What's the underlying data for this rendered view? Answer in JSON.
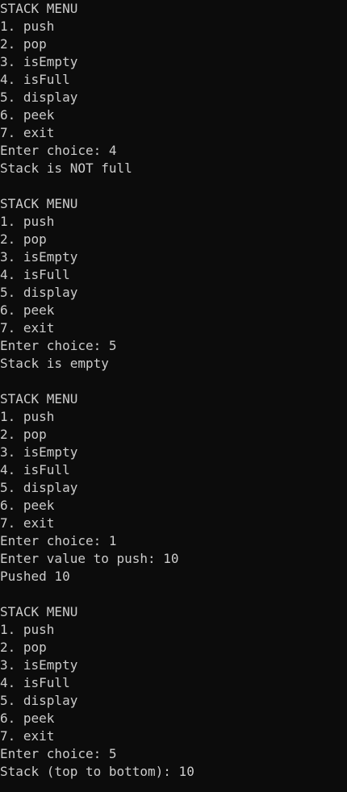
{
  "console": {
    "lines": [
      "STACK MENU",
      "1. push",
      "2. pop",
      "3. isEmpty",
      "4. isFull",
      "5. display",
      "6. peek",
      "7. exit",
      "Enter choice: 4",
      "Stack is NOT full",
      "",
      "STACK MENU",
      "1. push",
      "2. pop",
      "3. isEmpty",
      "4. isFull",
      "5. display",
      "6. peek",
      "7. exit",
      "Enter choice: 5",
      "Stack is empty",
      "",
      "STACK MENU",
      "1. push",
      "2. pop",
      "3. isEmpty",
      "4. isFull",
      "5. display",
      "6. peek",
      "7. exit",
      "Enter choice: 1",
      "Enter value to push: 10",
      "Pushed 10",
      "",
      "STACK MENU",
      "1. push",
      "2. pop",
      "3. isEmpty",
      "4. isFull",
      "5. display",
      "6. peek",
      "7. exit",
      "Enter choice: 5",
      "Stack (top to bottom): 10"
    ]
  }
}
